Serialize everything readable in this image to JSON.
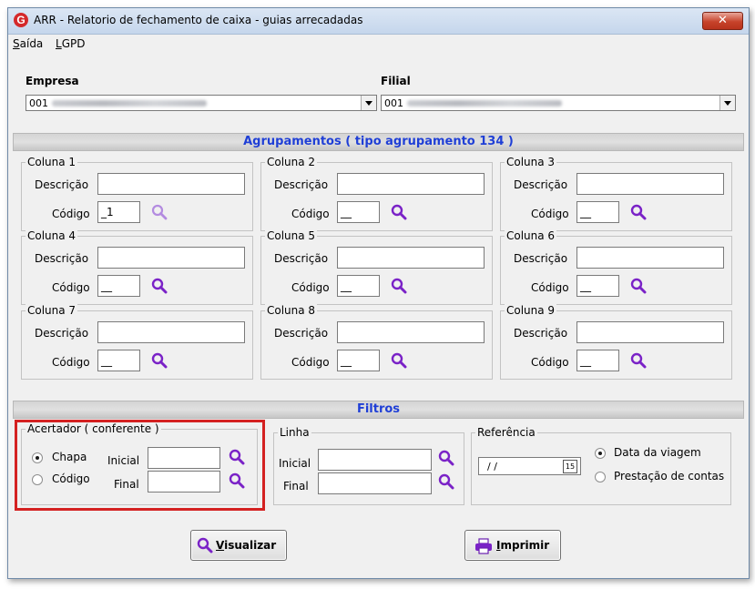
{
  "window": {
    "title": "ARR - Relatorio de fechamento de caixa - guias arrecadadas",
    "app_icon": "G",
    "close_glyph": "✕"
  },
  "menu": {
    "items": [
      {
        "accel": "S",
        "rest": "aída"
      },
      {
        "accel": "L",
        "rest": "GPD"
      }
    ]
  },
  "empresa": {
    "label": "Empresa",
    "value": "001"
  },
  "filial": {
    "label": "Filial",
    "value": "001"
  },
  "agrupamentos": {
    "header": "Agrupamentos ( tipo agrupamento 134 )",
    "descricao_label": "Descrição",
    "codigo_label": "Código",
    "columns": [
      {
        "title": "Coluna 1",
        "descricao": "",
        "codigo": "_1"
      },
      {
        "title": "Coluna 2",
        "descricao": "",
        "codigo": "__"
      },
      {
        "title": "Coluna 3",
        "descricao": "",
        "codigo": "__"
      },
      {
        "title": "Coluna 4",
        "descricao": "",
        "codigo": "__"
      },
      {
        "title": "Coluna 5",
        "descricao": "",
        "codigo": "__"
      },
      {
        "title": "Coluna 6",
        "descricao": "",
        "codigo": "__"
      },
      {
        "title": "Coluna 7",
        "descricao": "",
        "codigo": "__"
      },
      {
        "title": "Coluna 8",
        "descricao": "",
        "codigo": "__"
      },
      {
        "title": "Coluna 9",
        "descricao": "",
        "codigo": "__"
      }
    ]
  },
  "filtros": {
    "header": "Filtros",
    "acertador": {
      "legend": "Acertador ( conferente )",
      "radio_chapa": "Chapa",
      "radio_codigo": "Código",
      "selected": "Chapa",
      "inicial_label": "Inicial",
      "final_label": "Final"
    },
    "linha": {
      "legend": "Linha",
      "inicial_label": "Inicial",
      "final_label": "Final"
    },
    "referencia": {
      "legend": "Referência",
      "date_value": "/ /",
      "calendar_glyph": "15",
      "radio_viagem": "Data da viagem",
      "radio_prestacao": "Prestação de contas",
      "selected": "Data da viagem"
    }
  },
  "buttons": {
    "visualizar": {
      "accel": "V",
      "rest": "isualizar"
    },
    "imprimir": {
      "accel": "I",
      "rest": "mprimir"
    }
  },
  "colors": {
    "accent_blue": "#1f3fd6",
    "magnifier_purple": "#7a22c7",
    "highlight_red": "#d42121"
  },
  "icons": [
    "magnifier-icon",
    "printer-icon",
    "calendar-icon",
    "close-icon",
    "app-logo-icon"
  ]
}
